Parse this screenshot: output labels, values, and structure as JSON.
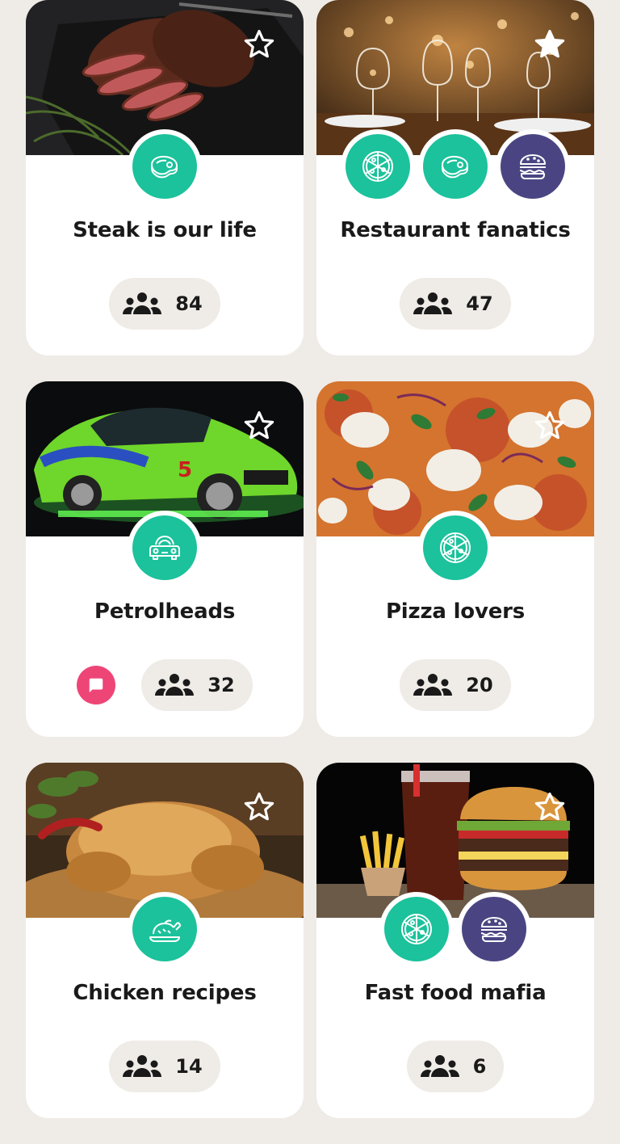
{
  "colors": {
    "background": "#efebe6",
    "card": "#ffffff",
    "teal": "#1bc29b",
    "purple": "#4a4582",
    "chat": "#ee4577",
    "pill": "#efebe6"
  },
  "groups": [
    {
      "title": "Steak is our life",
      "members": "84",
      "starred": false,
      "image": "grilled-steak-photo",
      "badges": [
        {
          "icon": "steak-icon",
          "color": "teal"
        }
      ],
      "has_chat": false
    },
    {
      "title": "Restaurant fanatics",
      "members": "47",
      "starred": true,
      "image": "restaurant-table-photo",
      "badges": [
        {
          "icon": "pizza-icon",
          "color": "teal"
        },
        {
          "icon": "steak-icon",
          "color": "teal"
        },
        {
          "icon": "burger-icon",
          "color": "purple"
        }
      ],
      "has_chat": false
    },
    {
      "title": "Petrolheads",
      "members": "32",
      "starred": false,
      "image": "green-sports-car-photo",
      "badges": [
        {
          "icon": "car-icon",
          "color": "teal"
        }
      ],
      "has_chat": true
    },
    {
      "title": "Pizza lovers",
      "members": "20",
      "starred": false,
      "image": "pizza-photo",
      "badges": [
        {
          "icon": "pizza-icon",
          "color": "teal"
        }
      ],
      "has_chat": false
    },
    {
      "title": "Chicken recipes",
      "members": "14",
      "starred": false,
      "image": "roast-chicken-photo",
      "badges": [
        {
          "icon": "chicken-icon",
          "color": "teal"
        }
      ],
      "has_chat": false
    },
    {
      "title": "Fast food mafia",
      "members": "6",
      "starred": false,
      "image": "burger-fries-cola-photo",
      "badges": [
        {
          "icon": "pizza-icon",
          "color": "teal"
        },
        {
          "icon": "burger-icon",
          "color": "purple"
        }
      ],
      "has_chat": false
    }
  ]
}
